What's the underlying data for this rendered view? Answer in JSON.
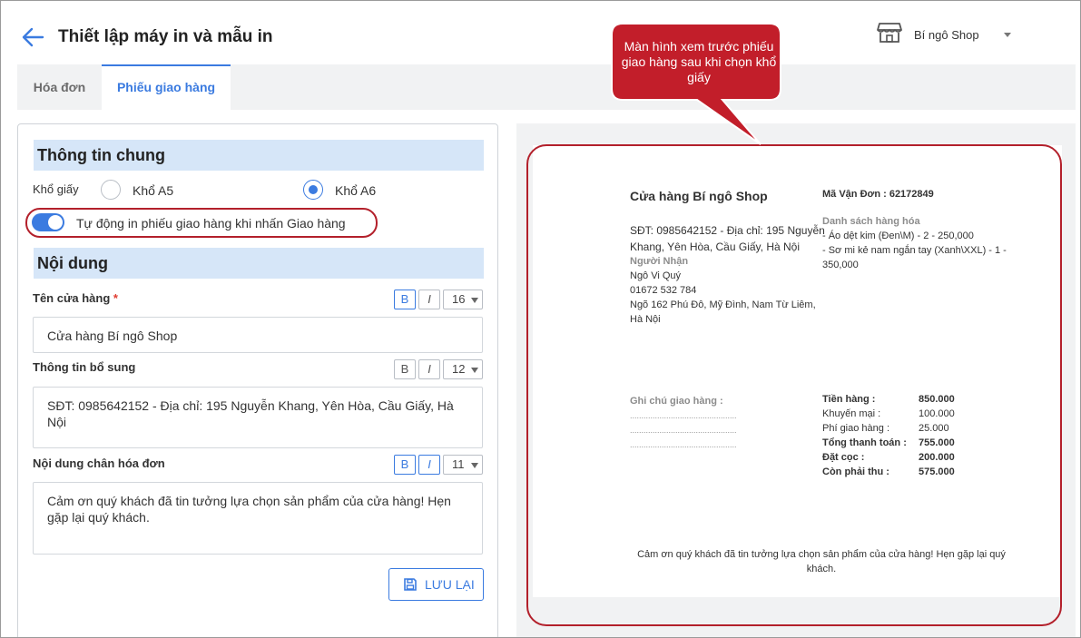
{
  "header": {
    "title": "Thiết lập máy in và mẫu in",
    "shop_name": "Bí ngô Shop"
  },
  "tabs": [
    {
      "label": "Hóa đơn"
    },
    {
      "label": "Phiếu giao hàng"
    }
  ],
  "general": {
    "heading": "Thông tin chung",
    "paper_label": "Khổ giấy",
    "option_a5": "Khổ A5",
    "option_a6": "Khổ A6",
    "auto_print_label": "Tự động in phiếu giao hàng khi nhấn Giao hàng"
  },
  "content": {
    "heading": "Nội dung",
    "store_name_label": "Tên cửa hàng",
    "store_name_value": "Cửa hàng Bí ngô Shop",
    "store_name_size": "16",
    "extra_label": "Thông tin bổ sung",
    "extra_value": "SĐT: 0985642152 - Địa chỉ: 195 Nguyễn Khang, Yên Hòa, Cầu Giấy, Hà Nội",
    "extra_size": "12",
    "footer_label": "Nội dung chân hóa đơn",
    "footer_value": "Cảm ơn quý khách đã tin tưởng lựa chọn sản phẩm của cửa hàng! Hẹn gặp lại quý khách.",
    "footer_size": "11",
    "bold": "B",
    "italic": "I",
    "required_mark": "*",
    "save_label": "LƯU LẠI"
  },
  "callout": "Màn hình xem trước phiếu giao hàng sau khi chọn khổ giấy",
  "preview": {
    "shop": "Cửa hàng Bí ngô Shop",
    "info_line1": "SĐT: 0985642152 - Địa chỉ: 195 Nguyễn",
    "info_line2": "Khang, Yên Hòa, Cầu Giấy, Hà Nội",
    "recipient_label": "Người Nhận",
    "recipient_name": "Ngô Vi Quý",
    "recipient_phone": "01672 532 784",
    "recipient_addr1": "Ngõ 162 Phú Đô, Mỹ Đình, Nam Từ Liêm,",
    "recipient_addr2": "Hà Nội",
    "waybill": "Mã Vận Đơn : 62172849",
    "items_label": "Danh sách hàng hóa",
    "item1": "- Áo dệt kim (Đen\\M) - 2 - 250,000",
    "item2": "- Sơ mi kẻ nam ngắn tay (Xanh\\XXL) - 1 -",
    "item2b": "350,000",
    "note_label": "Ghi chú giao hàng :",
    "dots": "...............................................",
    "summary": [
      {
        "k": "Tiền hàng :",
        "v": "850.000"
      },
      {
        "k": "Khuyến mại :",
        "v": "100.000"
      },
      {
        "k": "Phí giao hàng :",
        "v": "25.000"
      },
      {
        "k": "Tổng thanh toán :",
        "v": "755.000"
      },
      {
        "k": "Đặt cọc :",
        "v": "200.000"
      },
      {
        "k": "Còn phải thu :",
        "v": "575.000"
      }
    ],
    "footer_line1": "Cảm ơn quý khách đã tin tưởng lựa chọn sản phẩm của cửa hàng! Hẹn gặp lại quý",
    "footer_line2": "khách."
  },
  "colors": {
    "accent": "#3b7be0",
    "section_bg": "#d6e6f8",
    "annotation": "#b3202b"
  }
}
